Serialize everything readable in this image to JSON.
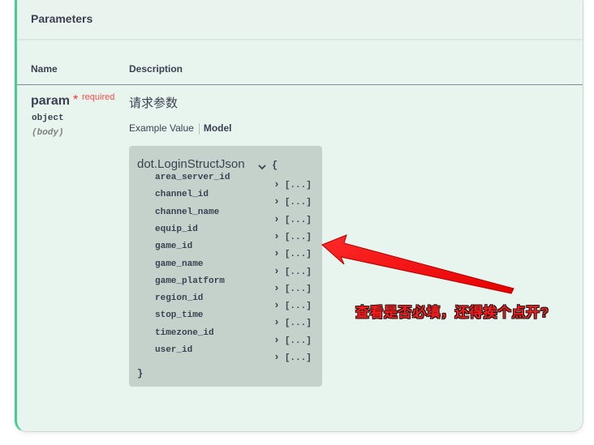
{
  "section": {
    "title": "Parameters"
  },
  "columns": {
    "name": "Name",
    "description": "Description"
  },
  "param": {
    "name": "param",
    "required_star": "*",
    "required_label": "required",
    "type": "object",
    "in": "(body)",
    "description": "请求参数"
  },
  "tabs": {
    "example": "Example Value",
    "model": "Model"
  },
  "model": {
    "title": "dot.LoginStructJson",
    "chevron": "⌄",
    "open_brace": "{",
    "close_brace": "}",
    "expand_label": "[...]",
    "properties": [
      "area_server_id",
      "channel_id",
      "channel_name",
      "equip_id",
      "game_id",
      "game_name",
      "game_platform",
      "region_id",
      "stop_time",
      "timezone_id",
      "user_id"
    ]
  },
  "annotation": {
    "text": "查看是否必填，还得挨个点开?",
    "color": "#ff1a1a"
  },
  "colors": {
    "accent": "#49cc90",
    "panel_bg": "#e8f4ee",
    "model_bg": "#c5d2cb"
  }
}
